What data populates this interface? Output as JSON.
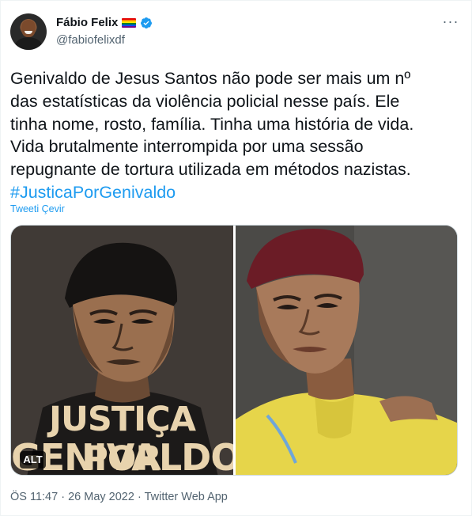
{
  "author": {
    "display_name": "Fábio Felix",
    "handle": "@fabiofelixdf",
    "flag_icon": "rainbow-flag-icon",
    "verified_icon": "verified-badge-icon"
  },
  "more_label": "···",
  "tweet": {
    "lines": [
      "Genivaldo de Jesus Santos não pode ser mais um nº",
      "das estatísticas da violência policial nesse país. Ele",
      "tinha nome, rosto, família. Tinha uma história de vida.",
      "Vida brutalmente interrompida por uma sessão",
      "repugnante de tortura utilizada em métodos nazistas."
    ],
    "hashtag": "#JusticaPorGenivaldo",
    "translate_label": "Tweeti Çevir"
  },
  "media": {
    "poster_line1": "JUSTIÇA POR",
    "poster_line2": "GENIVALDO",
    "alt_label": "ALT"
  },
  "meta": {
    "time": "ÖS 11:47",
    "separator": " · ",
    "date": "26 May 2022",
    "source": "Twitter Web App"
  },
  "colors": {
    "link": "#1d9bf0",
    "secondary_text": "#536471",
    "primary_text": "#0f1419"
  }
}
